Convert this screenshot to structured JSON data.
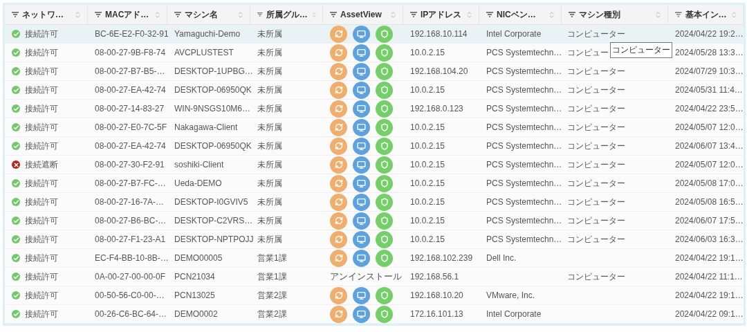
{
  "columns": [
    "ネットワ…",
    "MACアド…",
    "マシン名",
    "所属グル…",
    "AssetView",
    "IPアドレス",
    "NICベン…",
    "マシン種別",
    "基本イン…"
  ],
  "rows": [
    {
      "selected": true,
      "status": {
        "kind": "allowed",
        "label": "接続許可"
      },
      "mac": "BC-6E-E2-F0-32-91",
      "machine": "Yamaguchi-Demo",
      "group": "未所属",
      "asset": {
        "kind": "icons"
      },
      "ip": "192.168.10.114",
      "nic": "Intel Corporate",
      "type": "コンピューター",
      "info": "2024/04/22 19:2…"
    },
    {
      "selected": false,
      "status": {
        "kind": "allowed",
        "label": "接続許可"
      },
      "mac": "08-00-27-9B-F8-74",
      "machine": "AVCPLUSTEST",
      "group": "未所属",
      "asset": {
        "kind": "icons"
      },
      "ip": "10.0.2.15",
      "nic": "PCS Systemtechn…",
      "type": "コンピュー",
      "tooltip": "コンピューター",
      "info": "2024/05/28 13:3…"
    },
    {
      "selected": false,
      "status": {
        "kind": "allowed",
        "label": "接続許可"
      },
      "mac": "08-00-27-B7-B5-…",
      "machine": "DESKTOP-1UPBG…",
      "group": "未所属",
      "asset": {
        "kind": "icons"
      },
      "ip": "192.168.104.20",
      "nic": "PCS Systemtechn…",
      "type": "コンピューター",
      "info": "2024/07/29 10:3…"
    },
    {
      "selected": false,
      "status": {
        "kind": "allowed",
        "label": "接続許可"
      },
      "mac": "08-00-27-EA-42-74",
      "machine": "DESKTOP-06950QK",
      "group": "未所属",
      "asset": {
        "kind": "icons"
      },
      "ip": "10.0.2.15",
      "nic": "PCS Systemtechn…",
      "type": "コンピューター",
      "info": "2024/05/31 11:4…"
    },
    {
      "selected": false,
      "status": {
        "kind": "allowed",
        "label": "接続許可"
      },
      "mac": "08-00-27-14-83-27",
      "machine": "WIN-9NSGS10M6…",
      "group": "未所属",
      "asset": {
        "kind": "icons"
      },
      "ip": "192.168.0.123",
      "nic": "PCS Systemtechn…",
      "type": "コンピューター",
      "info": "2024/04/22 23:5…"
    },
    {
      "selected": false,
      "status": {
        "kind": "allowed",
        "label": "接続許可"
      },
      "mac": "08-00-27-E0-7C-5F",
      "machine": "Nakagawa-Client",
      "group": "未所属",
      "asset": {
        "kind": "icons"
      },
      "ip": "10.0.2.15",
      "nic": "PCS Systemtechn…",
      "type": "コンピューター",
      "info": "2024/05/07 12:0…"
    },
    {
      "selected": false,
      "status": {
        "kind": "allowed",
        "label": "接続許可"
      },
      "mac": "08-00-27-EA-42-74",
      "machine": "DESKTOP-06950QK",
      "group": "未所属",
      "asset": {
        "kind": "icons"
      },
      "ip": "10.0.2.15",
      "nic": "PCS Systemtechn…",
      "type": "コンピューター",
      "info": "2024/06/07 13:4…"
    },
    {
      "selected": false,
      "status": {
        "kind": "blocked",
        "label": "接続遮断"
      },
      "mac": "08-00-27-30-F2-91",
      "machine": "soshiki-Client",
      "group": "未所属",
      "asset": {
        "kind": "icons"
      },
      "ip": "10.0.2.15",
      "nic": "PCS Systemtechn…",
      "type": "コンピューター",
      "info": "2024/05/07 12:0…"
    },
    {
      "selected": false,
      "status": {
        "kind": "allowed",
        "label": "接続許可"
      },
      "mac": "08-00-27-B7-FC-…",
      "machine": "Ueda-DEMO",
      "group": "未所属",
      "asset": {
        "kind": "icons"
      },
      "ip": "10.0.2.15",
      "nic": "PCS Systemtechn…",
      "type": "コンピューター",
      "info": "2024/05/08 17:0…"
    },
    {
      "selected": false,
      "status": {
        "kind": "allowed",
        "label": "接続許可"
      },
      "mac": "08-00-27-16-7A-…",
      "machine": "DESKTOP-I0GVIV5",
      "group": "未所属",
      "asset": {
        "kind": "icons"
      },
      "ip": "10.0.2.15",
      "nic": "PCS Systemtechn…",
      "type": "コンピューター",
      "info": "2024/05/08 16:5…"
    },
    {
      "selected": false,
      "status": {
        "kind": "allowed",
        "label": "接続許可"
      },
      "mac": "08-00-27-B6-BC-…",
      "machine": "DESKTOP-C2VRS…",
      "group": "未所属",
      "asset": {
        "kind": "icons"
      },
      "ip": "10.0.2.15",
      "nic": "PCS Systemtechn…",
      "type": "コンピューター",
      "info": "2024/06/07 17:5…"
    },
    {
      "selected": false,
      "status": {
        "kind": "allowed",
        "label": "接続許可"
      },
      "mac": "08-00-27-F1-23-A1",
      "machine": "DESKTOP-NPTPOJJ",
      "group": "未所属",
      "asset": {
        "kind": "icons"
      },
      "ip": "10.0.2.15",
      "nic": "PCS Systemtechn…",
      "type": "コンピューター",
      "info": "2024/06/03 16:3…"
    },
    {
      "selected": false,
      "status": {
        "kind": "allowed",
        "label": "接続許可"
      },
      "mac": "EC-F4-BB-10-8B-…",
      "machine": "DEMO00005",
      "group": "営業1課",
      "asset": {
        "kind": "icons"
      },
      "ip": "192.168.102.239",
      "nic": "Dell Inc.",
      "info": "2024/04/22 19:1…"
    },
    {
      "selected": false,
      "status": {
        "kind": "allowed",
        "label": "接続許可"
      },
      "mac": "0A-00-27-00-00-0F",
      "machine": "PCN21034",
      "group": "営業1課",
      "asset": {
        "kind": "text",
        "text": "アンインストール"
      },
      "ip": "192.168.56.1",
      "type": "コンピューター",
      "info": "2024/04/22 11:1…"
    },
    {
      "selected": false,
      "status": {
        "kind": "allowed",
        "label": "接続許可"
      },
      "mac": "00-50-56-C0-00-…",
      "machine": "PCN13025",
      "group": "営業2課",
      "asset": {
        "kind": "icons"
      },
      "ip": "192.168.10.20",
      "nic": "VMware, Inc.",
      "info": "2024/04/22 19:1…"
    },
    {
      "selected": false,
      "status": {
        "kind": "allowed",
        "label": "接続許可"
      },
      "mac": "00-26-C6-BC-64-…",
      "machine": "DEMO0002",
      "group": "営業2課",
      "asset": {
        "kind": "icons"
      },
      "ip": "172.16.101.13",
      "nic": "Intel Corporate",
      "info": "2024/04/22 09:1…"
    }
  ]
}
